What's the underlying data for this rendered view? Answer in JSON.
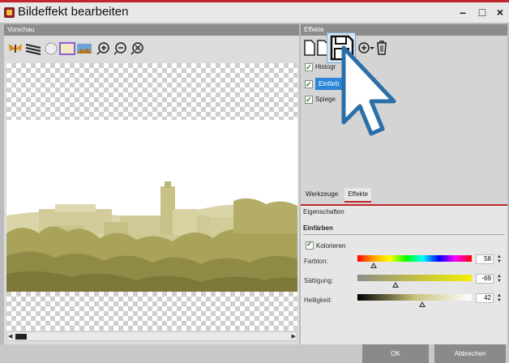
{
  "window": {
    "title": "Bildeffekt bearbeiten",
    "controls": {
      "minimize": "–",
      "maximize": "□",
      "close": "×"
    }
  },
  "preview": {
    "header": "Vorschau",
    "toolbar_icons": [
      "butterfly-icon",
      "zebra-icon",
      "circle-icon",
      "selected-frame-icon",
      "landscape-icon",
      "zoom-in-icon",
      "zoom-out-icon",
      "zoom-fit-icon"
    ]
  },
  "effects": {
    "header": "Effekte",
    "toolbar_icons": [
      "new-page-icon",
      "copy-icon",
      "save-icon",
      "add-effect-icon",
      "delete-icon"
    ],
    "items": [
      {
        "label": "Histogr",
        "checked": true,
        "selected": false
      },
      {
        "label": "Einfärb",
        "checked": true,
        "selected": true
      },
      {
        "label": "Spiege",
        "checked": true,
        "selected": false
      }
    ],
    "tabs": [
      {
        "label": "Werkzeuge",
        "active": false
      },
      {
        "label": "Effekte",
        "active": true
      }
    ]
  },
  "properties": {
    "title": "Eigenschaften",
    "section": "Einfärben",
    "colorize_label": "Kolorieren",
    "colorize_checked": true,
    "sliders": [
      {
        "label": "Farbton:",
        "value": "58",
        "position": 0.14
      },
      {
        "label": "Sättigung:",
        "value": "-69",
        "position": 0.33
      },
      {
        "label": "Helligkeit:",
        "value": "42",
        "position": 0.57
      }
    ]
  },
  "footer": {
    "ok_label": "OK",
    "cancel_label": "Abbrechen"
  },
  "colors": {
    "accent_red": "#c0282c",
    "selection_blue": "#2b86d9",
    "tint": "#c9c07a"
  }
}
